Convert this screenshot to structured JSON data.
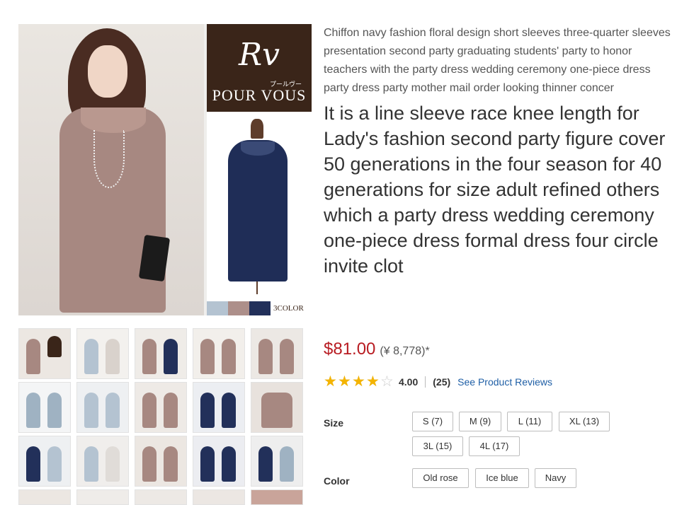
{
  "product": {
    "subtitle": "Chiffon navy fashion floral design short sleeves three-quarter sleeves presentation second party graduating students' party to honor teachers with the party dress wedding ceremony one-piece dress party dress party mother mail order looking thinner concer",
    "title": "It is a line sleeve race knee length for Lady's fashion second party figure cover 50 generations in the four season for 40 generations for size adult refined others which a party dress wedding ceremony one-piece dress formal dress four circle invite clot"
  },
  "gallery": {
    "brand_mark": "Rv",
    "brand_kana": "プールヴー",
    "brand_name": "POUR VOUS",
    "color_count": "3COLOR",
    "swatches": [
      "#b4c3d1",
      "#ad8f8a",
      "#22305a"
    ]
  },
  "price": {
    "usd": "$81.00",
    "yen": "(¥ 8,778)*"
  },
  "rating": {
    "value": "4.00",
    "count": "(25)",
    "reviews_link": "See Product Reviews",
    "stars": 4.0
  },
  "options": {
    "size_label": "Size",
    "sizes": [
      "S (7)",
      "M (9)",
      "L (11)",
      "XL (13)",
      "3L (15)",
      "4L (17)"
    ],
    "color_label": "Color",
    "colors": [
      "Old rose",
      "Ice blue",
      "Navy"
    ]
  }
}
